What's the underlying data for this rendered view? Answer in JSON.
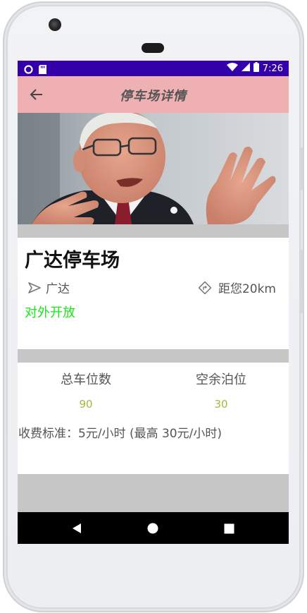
{
  "status_bar": {
    "time": "7:26"
  },
  "app_bar": {
    "title": "停车场详情"
  },
  "lot": {
    "name": "广达停车场",
    "address": "广达",
    "distance": "距您20km",
    "status": "对外开放"
  },
  "stats": {
    "total_label": "总车位数",
    "total_value": "90",
    "free_label": "空余泊位",
    "free_value": "30"
  },
  "fee": {
    "text": "收费标准：5元/小时 (最高 30元/小时)"
  },
  "colors": {
    "status_bar": "#3300aa",
    "app_bar": "#eeb0b2",
    "open_status": "#19e619",
    "stat_value": "#a4b83a"
  }
}
